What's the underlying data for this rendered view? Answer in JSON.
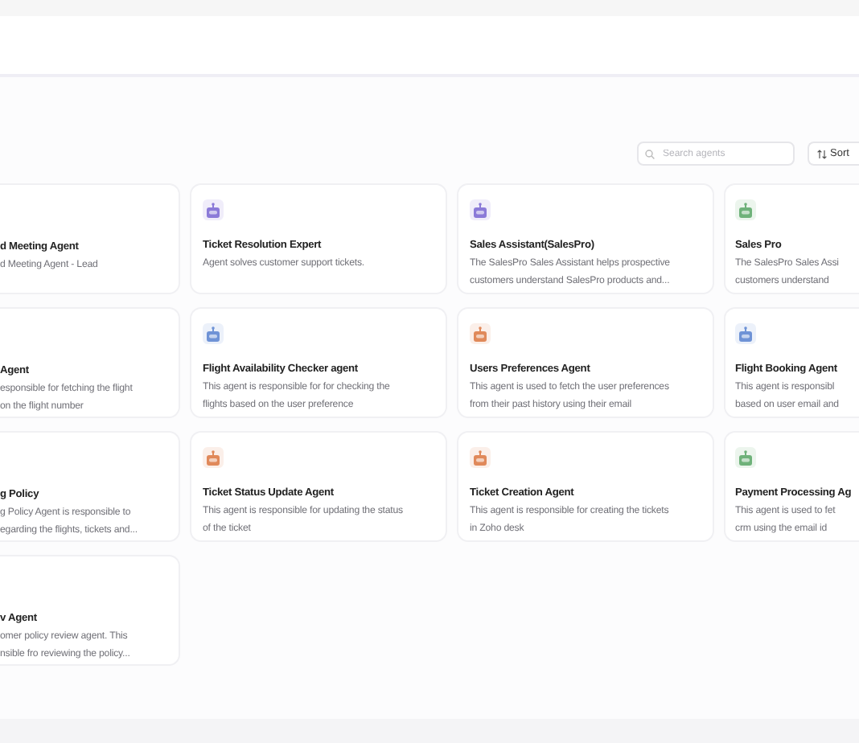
{
  "toolbar": {
    "search": {
      "placeholder": "Search agents"
    },
    "sort_button": {
      "label": "Sort"
    }
  },
  "agents": [
    {
      "title": "d Meeting Agent",
      "lines": [
        "d Meeting Agent - Lead"
      ]
    },
    {
      "title": "Ticket Resolution Expert",
      "color": "#8b7ad8",
      "lines": [
        "Agent solves customer support tickets."
      ]
    },
    {
      "title": "Sales Assistant(SalesPro)",
      "color": "#8b7ad8",
      "lines": [
        "The SalesPro Sales Assistant helps prospective",
        "customers understand SalesPro products and..."
      ]
    },
    {
      "title": "Sales Pro",
      "color": "#6fb27a",
      "lines": [
        "The SalesPro Sales Assi",
        "customers understand"
      ]
    },
    {
      "title": "Agent",
      "lines": [
        "esponsible for fetching the flight",
        "on the flight number"
      ]
    },
    {
      "title": "Flight Availability Checker agent",
      "color": "#6f93d6",
      "lines": [
        "This agent is responsible for for checking the",
        "flights based on the user preference"
      ]
    },
    {
      "title": "Users Preferences Agent",
      "color": "#e0895a",
      "lines": [
        "This agent is used to fetch the user preferences",
        "from their past history using their email"
      ]
    },
    {
      "title": "Flight Booking Agent",
      "color": "#6f93d6",
      "lines": [
        "This agent is responsibl",
        "based on user email and"
      ]
    },
    {
      "title": "g Policy",
      "lines": [
        "g Policy Agent is responsible to",
        "egarding the flights, tickets and..."
      ]
    },
    {
      "title": "Ticket Status Update Agent",
      "color": "#e0895a",
      "lines": [
        "This agent is responsible for updating the status",
        "of the ticket"
      ]
    },
    {
      "title": "Ticket Creation Agent",
      "color": "#e0895a",
      "lines": [
        "This agent is responsible for creating the tickets",
        "in Zoho desk"
      ]
    },
    {
      "title": "Payment Processing Ag",
      "color": "#6fb27a",
      "lines": [
        "This agent is used to fet",
        "crm using the email id"
      ]
    },
    {
      "title": "v Agent",
      "lines": [
        "omer policy review agent. This",
        "nsible fro reviewing the policy..."
      ]
    }
  ]
}
